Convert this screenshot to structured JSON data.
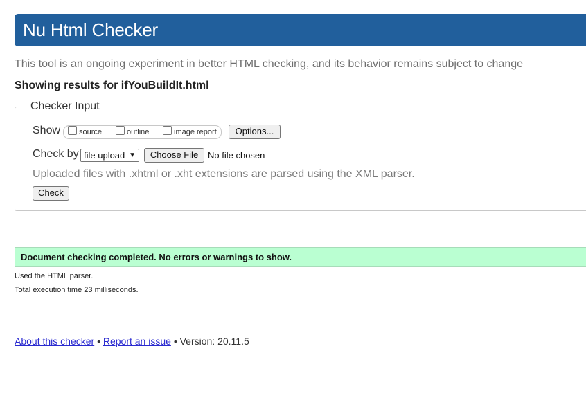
{
  "header": {
    "title": "Nu Html Checker"
  },
  "intro": "This tool is an ongoing experiment in better HTML checking, and its behavior remains subject to change",
  "results_for": "Showing results for ifYouBuildIt.html",
  "checker_input": {
    "legend": "Checker Input",
    "show_label": "Show",
    "show_options": [
      "source",
      "outline",
      "image report"
    ],
    "options_button": "Options...",
    "check_by_label": "Check by",
    "check_by_selected": "file upload",
    "choose_file_button": "Choose File",
    "no_file_text": "No file chosen",
    "xml_note": "Uploaded files with .xhtml or .xht extensions are parsed using the XML parser.",
    "check_button": "Check"
  },
  "result": {
    "success_message": "Document checking completed. No errors or warnings to show.",
    "parser_used": "Used the HTML parser.",
    "execution_time": "Total execution time 23 milliseconds."
  },
  "footer": {
    "about_link": "About this checker",
    "separator": "•",
    "report_link": "Report an issue",
    "version": "Version: 20.11.5"
  },
  "colors": {
    "header_bg": "#215f9c",
    "success_bg": "#baffd2",
    "link": "#0000ee"
  }
}
